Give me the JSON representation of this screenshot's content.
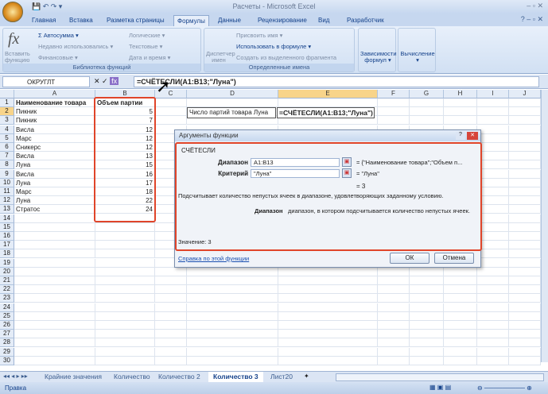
{
  "window": {
    "title": "Расчеты - Microsoft Excel"
  },
  "tabs": [
    "Главная",
    "Вставка",
    "Разметка страницы",
    "Формулы",
    "Данные",
    "Рецензирование",
    "Вид",
    "Разработчик"
  ],
  "active_tab": "Формулы",
  "ribbon": {
    "insert_function": "Вставить функцию",
    "autosum": "Σ Автосумма ▾",
    "recent": "Недавно использовались ▾",
    "financial": "Финансовые ▾",
    "logical": "Логические ▾",
    "text": "Текстовые ▾",
    "datetime": "Дата и время ▾",
    "lib_group": "Библиотека функций",
    "name_manager": "Диспетчер имен",
    "assign_name": "Присвоить имя ▾",
    "use_in_formula": "Использовать в формуле ▾",
    "create_from_sel": "Создать из выделенного фрагмента",
    "names_group": "Определенные имена",
    "dependencies": "Зависимости формул ▾",
    "calculation": "Вычисление ▾"
  },
  "formula_bar": {
    "name_box": "ОКРУГЛТ",
    "formula": "=СЧЁТЕСЛИ(A1:B13;\"Луна\")"
  },
  "columns": [
    "A",
    "B",
    "C",
    "D",
    "E",
    "F",
    "G",
    "H",
    "I",
    "J"
  ],
  "rows": [
    [
      "Наименование товара",
      "Объем партии"
    ],
    [
      "Пикник",
      "5"
    ],
    [
      "Пикник",
      "7"
    ],
    [
      "Висла",
      "12"
    ],
    [
      "Марс",
      "12"
    ],
    [
      "Сникерс",
      "12"
    ],
    [
      "Висла",
      "13"
    ],
    [
      "Луна",
      "15"
    ],
    [
      "Висла",
      "16"
    ],
    [
      "Луна",
      "17"
    ],
    [
      "Марс",
      "18"
    ],
    [
      "Луна",
      "22"
    ],
    [
      "Стратос",
      "24"
    ]
  ],
  "d2_label": "Число партий товара Луна",
  "e2_formula": "=СЧЁТЕСЛИ(A1:B13;\"Луна\")",
  "dialog": {
    "title": "Аргументы функции",
    "function": "СЧЁТЕСЛИ",
    "range_label": "Диапазон",
    "range_value": "A1:B13",
    "range_result": "= {\"Наименование товара\";\"Объем п...",
    "criteria_label": "Критерий",
    "criteria_value": "\"Луна\"",
    "criteria_result": "= \"Луна\"",
    "result": "= 3",
    "description": "Подсчитывает количество непустых ячеек в диапазоне, удовлетворяющих заданному условию.",
    "arg_name": "Диапазон",
    "arg_desc": "диапазон, в котором подсчитывается количество непустых ячеек.",
    "value_label": "Значение:  3",
    "help_link": "Справка по этой функции",
    "ok": "ОК",
    "cancel": "Отмена"
  },
  "sheets": [
    "Крайние значения",
    "Количество",
    "Количество 2",
    "Количество 3",
    "Лист20"
  ],
  "active_sheet": "Количество 3",
  "status": "Правка",
  "colors": {
    "highlight": "#e0452a",
    "accent": "#15428b"
  }
}
